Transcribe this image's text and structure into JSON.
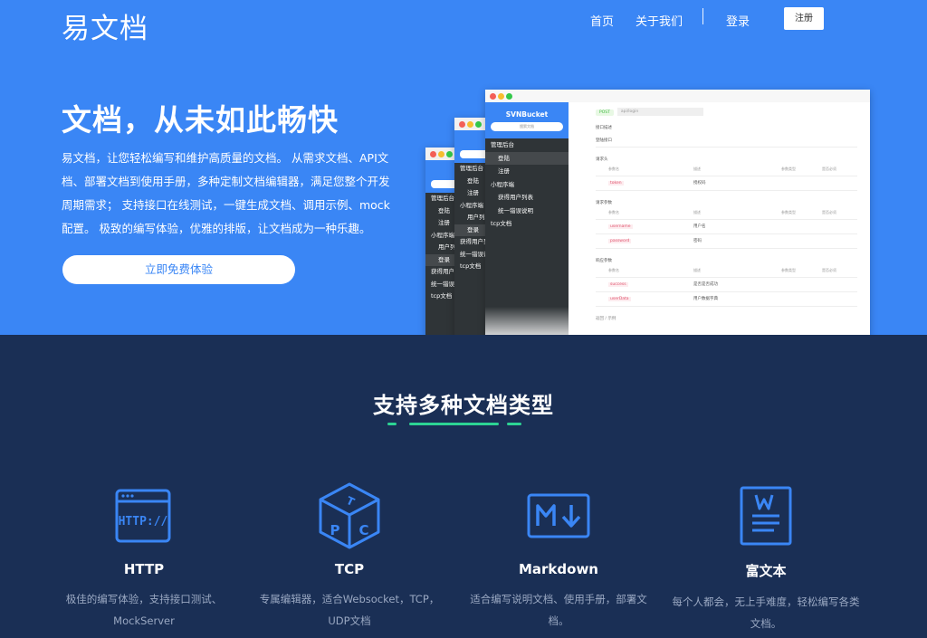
{
  "brand": {
    "logo": "易文档"
  },
  "nav": {
    "home": "首页",
    "about": "关于我们",
    "login": "登录",
    "register": "注册"
  },
  "hero": {
    "title": "文档，从未如此畅快",
    "description": "易文档，让您轻松编写和维护高质量的文档。 从需求文档、API文档、部署文档到使用手册，多种定制文档编辑器，满足您整个开发周期需求； 支持接口在线测试，一键生成文档、调用示例、mock配置。 极致的编写体验，优雅的排版，让文档成为一种乐趣。",
    "cta": "立即免费体验"
  },
  "mockup": {
    "app_title": "SVNBucket",
    "search_placeholder": "搜索文档",
    "menu": [
      "管理后台",
      "登陆",
      "注册",
      "小程序端",
      "获得用户列表",
      "统一错误说明",
      "tcp文档"
    ],
    "win2_menu": [
      "管理后台",
      "登陆",
      "注册",
      "小程序端",
      "用户列表",
      "登录",
      "获得用户列",
      "统一错误说",
      "tcp文档"
    ],
    "win3_menu": [
      "管理后台",
      "登陆",
      "注册",
      "小程序端",
      "用户列表",
      "登录",
      "获得用户列",
      "统一错误说",
      "tcp文档"
    ],
    "method": "POST",
    "url": "api/login",
    "interface_desc": "接口描述",
    "interface_name": "登陆接口",
    "request_header": "请求头",
    "request_params": "请求参数",
    "response_params": "响应参数",
    "col_name": "参数名",
    "col_desc": "描述",
    "col_type": "参数类型",
    "col_required": "是否必须",
    "header_rows": [
      {
        "name": "token",
        "desc": "授权码"
      }
    ],
    "param_rows": [
      {
        "name": "username",
        "desc": "用户名"
      },
      {
        "name": "password",
        "desc": "密码"
      }
    ],
    "response_rows": [
      {
        "name": "success",
        "desc": "是否是否成功"
      },
      {
        "name": "userData",
        "desc": "用户数据字典"
      }
    ],
    "footer": "返回 / 示例"
  },
  "section": {
    "title": "支持多种文档类型"
  },
  "features": [
    {
      "icon": "http-icon",
      "name": "HTTP",
      "desc": "极佳的编写体验，支持接口测试、MockServer"
    },
    {
      "icon": "tcp-cube-icon",
      "name": "TCP",
      "desc": "专属编辑器，适合Websocket，TCP，UDP文档"
    },
    {
      "icon": "markdown-icon",
      "name": "Markdown",
      "desc": "适合编写说明文档、使用手册，部署文档。"
    },
    {
      "icon": "word-document-icon",
      "name": "富文本",
      "desc": "每个人都会，无上手难度，轻松编写各类文档。"
    }
  ],
  "colors": {
    "hero_bg": "#3a86f5",
    "section_bg": "#1a2f55",
    "accent": "#2dd494",
    "icon": "#3a86f5"
  }
}
